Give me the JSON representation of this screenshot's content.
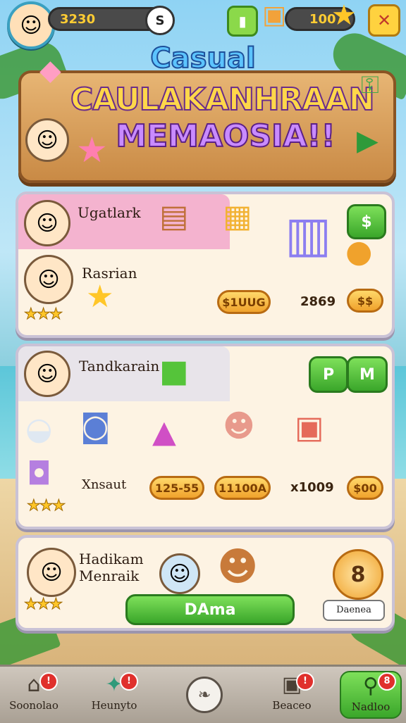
{
  "header": {
    "coins_value": "3230",
    "coins_button": "S",
    "gems_value": "100"
  },
  "title": {
    "small": "Casual",
    "main": "CAULAKANHRAAN",
    "sub": "MEMAOSIA!!"
  },
  "panel1": {
    "row1_label": "Ugatlark",
    "row2_label": "Rasrian",
    "price_button": "$1UUG",
    "amount": "2869",
    "dollar_button": "$$",
    "top_right_button": "$"
  },
  "panel2": {
    "row1_label": "Tandkarain",
    "row2_label": "Xnsaut",
    "price1": "125-55",
    "price2": "11100A",
    "amount": "x1009",
    "price3": "$00",
    "btn_a": "P",
    "btn_b": "M"
  },
  "panel3": {
    "label_line1": "Hadikam",
    "label_line2": "Menraik",
    "action_button": "DAma",
    "side_badge": "8",
    "side_label": "Daenea"
  },
  "nav": {
    "items": [
      {
        "label": "Soonolao",
        "badge": "!"
      },
      {
        "label": "Heunyto",
        "badge": "!"
      },
      {
        "label": "",
        "badge": ""
      },
      {
        "label": "Beaceo",
        "badge": "!"
      },
      {
        "label": "Nadloo",
        "badge": "8"
      }
    ]
  },
  "colors": {
    "accent_green": "#3aa62a",
    "gold": "#f0a22c",
    "panel_bg": "#fdf3e3",
    "board_wood": "#c98a45"
  }
}
